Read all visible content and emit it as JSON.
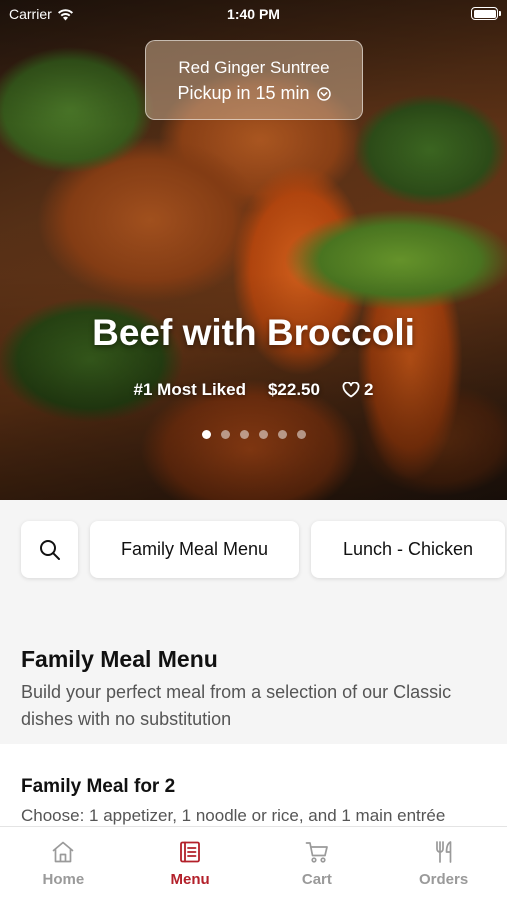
{
  "status_bar": {
    "carrier": "Carrier",
    "time": "1:40 PM"
  },
  "pickup": {
    "restaurant": "Red Ginger Suntree",
    "eta": "Pickup in 15 min"
  },
  "hero": {
    "dish_name": "Beef with Broccoli",
    "badge": "#1 Most Liked",
    "price": "$22.50",
    "likes": "2",
    "carousel_total": 6,
    "carousel_active": 1
  },
  "categories": {
    "search_icon": "search-icon",
    "items": [
      "Family Meal Menu",
      "Lunch - Chicken"
    ]
  },
  "section": {
    "title": "Family Meal Menu",
    "description": "Build your perfect meal from a selection of our Classic dishes with no substitution"
  },
  "menu_item": {
    "title": "Family Meal for 2",
    "description": "Choose: 1 appetizer, 1 noodle or rice, and 1 main entrée"
  },
  "tabbar": {
    "active": "Menu",
    "active_color": "#b3202a",
    "tabs": [
      {
        "label": "Home",
        "icon": "home-icon"
      },
      {
        "label": "Menu",
        "icon": "menu-icon"
      },
      {
        "label": "Cart",
        "icon": "cart-icon"
      },
      {
        "label": "Orders",
        "icon": "orders-icon"
      }
    ]
  }
}
